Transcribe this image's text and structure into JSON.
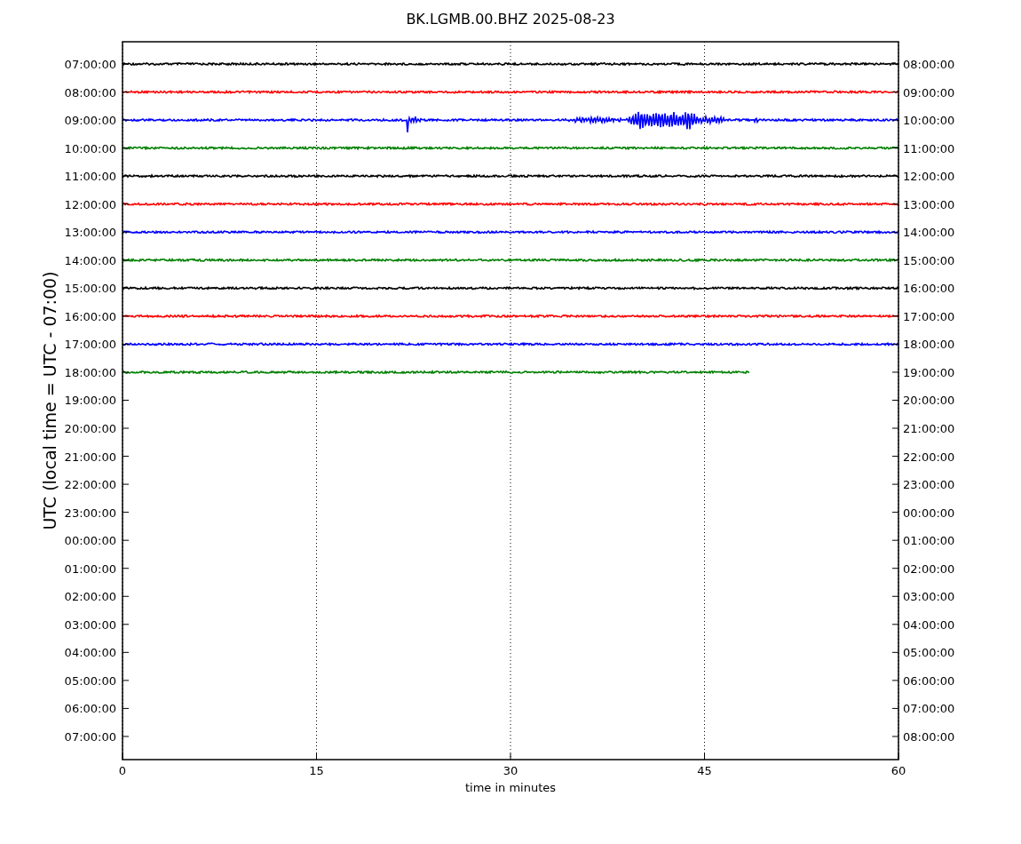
{
  "plot": {
    "title": "BK.LGMB.00.BHZ 2025-08-23",
    "xlabel": "time in minutes",
    "ylabel": "UTC (local time = UTC - 07:00)",
    "x_tick_labels": [
      "0",
      "15",
      "30",
      "45",
      "60"
    ],
    "left_labels": [
      "07:00:00",
      "08:00:00",
      "09:00:00",
      "10:00:00",
      "11:00:00",
      "12:00:00",
      "13:00:00",
      "14:00:00",
      "15:00:00",
      "16:00:00",
      "17:00:00",
      "18:00:00",
      "19:00:00",
      "20:00:00",
      "21:00:00",
      "22:00:00",
      "23:00:00",
      "00:00:00",
      "01:00:00",
      "02:00:00",
      "03:00:00",
      "04:00:00",
      "05:00:00",
      "06:00:00",
      "07:00:00"
    ],
    "right_labels": [
      "08:00:00",
      "09:00:00",
      "10:00:00",
      "11:00:00",
      "12:00:00",
      "13:00:00",
      "14:00:00",
      "15:00:00",
      "16:00:00",
      "17:00:00",
      "18:00:00",
      "19:00:00",
      "20:00:00",
      "21:00:00",
      "22:00:00",
      "23:00:00",
      "00:00:00",
      "01:00:00",
      "02:00:00",
      "03:00:00",
      "04:00:00",
      "05:00:00",
      "06:00:00",
      "07:00:00",
      "08:00:00"
    ],
    "traces": [
      {
        "color": "#000000",
        "kind": "quiet",
        "level": 1
      },
      {
        "color": "#ff0000",
        "kind": "quiet",
        "level": 1
      },
      {
        "color": "#0000ff",
        "kind": "event",
        "level": 1
      },
      {
        "color": "#008000",
        "kind": "quiet",
        "level": 1
      },
      {
        "color": "#000000",
        "kind": "quiet",
        "level": 1
      },
      {
        "color": "#ff0000",
        "kind": "quiet",
        "level": 1
      },
      {
        "color": "#0000ff",
        "kind": "quiet",
        "level": 1
      },
      {
        "color": "#008000",
        "kind": "quiet",
        "level": 1
      },
      {
        "color": "#000000",
        "kind": "quiet",
        "level": 1
      },
      {
        "color": "#ff0000",
        "kind": "quiet",
        "level": 1
      },
      {
        "color": "#0000ff",
        "kind": "quiet",
        "level": 1
      },
      {
        "color": "#008000",
        "kind": "quiet",
        "level": 0.808
      }
    ]
  }
}
